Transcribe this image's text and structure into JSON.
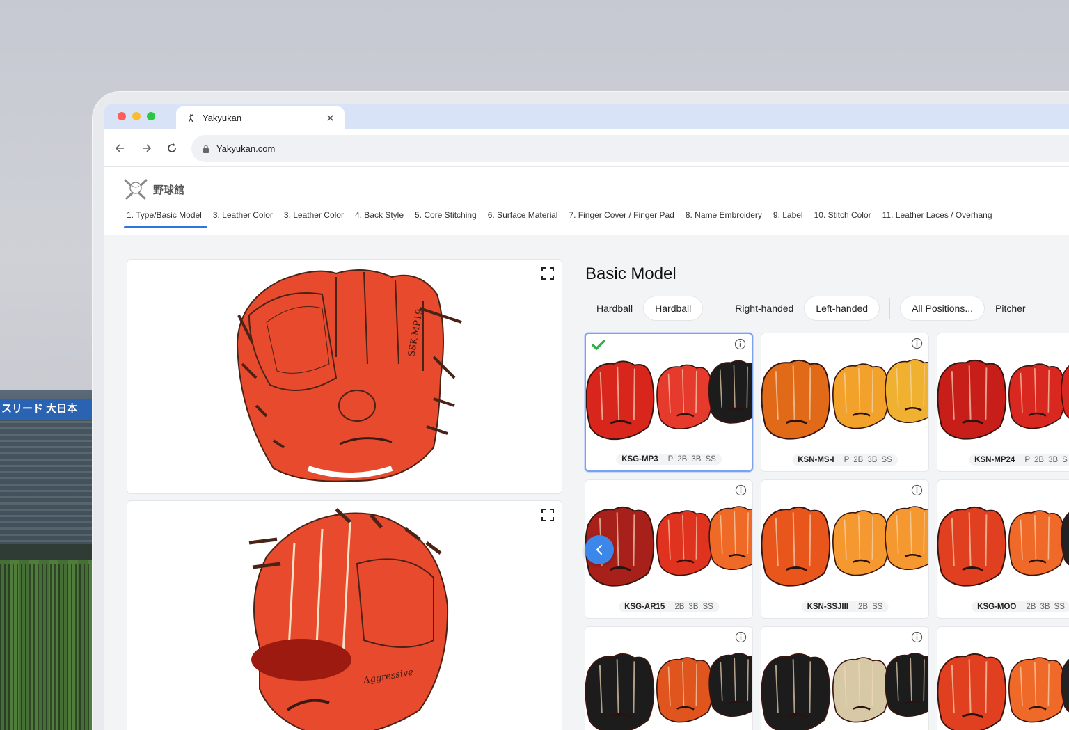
{
  "background": {
    "stadium_banner": "スリード 大日本"
  },
  "browser": {
    "tab_title": "Yakyukan",
    "url": "Yakyukan.com",
    "traffic_lights": [
      "#fd5f57",
      "#fdbc2e",
      "#28c840"
    ]
  },
  "site": {
    "logo_text": "野球館",
    "steps": [
      "1. Type/Basic Model",
      "3. Leather Color",
      "3. Leather Color",
      "4. Back Style",
      "5. Core Stitching",
      "6. Surface Material",
      "7. Finger Cover / Finger Pad",
      "8. Name Embroidery",
      "9. Label",
      "10. Stitch Color",
      "11. Leather Laces / Overhang"
    ],
    "active_step": 0,
    "accent_color": "#2f74e4"
  },
  "panel": {
    "title": "Basic Model",
    "filters": {
      "ball": [
        "Hardball",
        "Hardball"
      ],
      "hand": [
        "Right-handed",
        "Left-handed"
      ],
      "position": [
        "All Positions...",
        "Pitcher"
      ]
    },
    "cards": [
      {
        "model": "KSG-MP3",
        "positions": [
          "P",
          "2B",
          "3B",
          "SS"
        ],
        "selected": true,
        "colors": [
          "#d8261c",
          "#e63a2c",
          "#1c1c1c"
        ]
      },
      {
        "model": "KSN-MS-I",
        "positions": [
          "P",
          "2B",
          "3B",
          "SS"
        ],
        "selected": false,
        "colors": [
          "#e06a18",
          "#f2a22a",
          "#f0b030"
        ]
      },
      {
        "model": "KSN-MP24",
        "positions": [
          "P",
          "2B",
          "3B",
          "S"
        ],
        "selected": false,
        "colors": [
          "#c81e1a",
          "#d82820",
          "#d82820"
        ]
      },
      {
        "model": "KSG-AR15",
        "positions": [
          "2B",
          "3B",
          "SS"
        ],
        "selected": false,
        "colors": [
          "#a8201a",
          "#e0331f",
          "#ee6a26"
        ]
      },
      {
        "model": "KSN-SSJIII",
        "positions": [
          "2B",
          "SS"
        ],
        "selected": false,
        "colors": [
          "#e8561c",
          "#f59830",
          "#f59830"
        ]
      },
      {
        "model": "KSG-MOO",
        "positions": [
          "2B",
          "3B",
          "SS"
        ],
        "selected": false,
        "colors": [
          "#e0401f",
          "#ef6a28",
          "#222222"
        ]
      },
      {
        "model": "",
        "positions": [],
        "selected": false,
        "colors": [
          "#1c1c1c",
          "#e0551e",
          "#1c1c1c"
        ]
      },
      {
        "model": "",
        "positions": [],
        "selected": false,
        "colors": [
          "#1c1c1c",
          "#d8c9a6",
          "#1c1c1c"
        ]
      },
      {
        "model": "",
        "positions": [],
        "selected": false,
        "colors": [
          "#e0401f",
          "#ef6a28",
          "#222222"
        ]
      }
    ]
  },
  "preview": {
    "glove_color": "#e84a2d",
    "lace_color": "#4a2216",
    "front_brand": "SSK-MP19",
    "back_brand": "Aggressive"
  }
}
